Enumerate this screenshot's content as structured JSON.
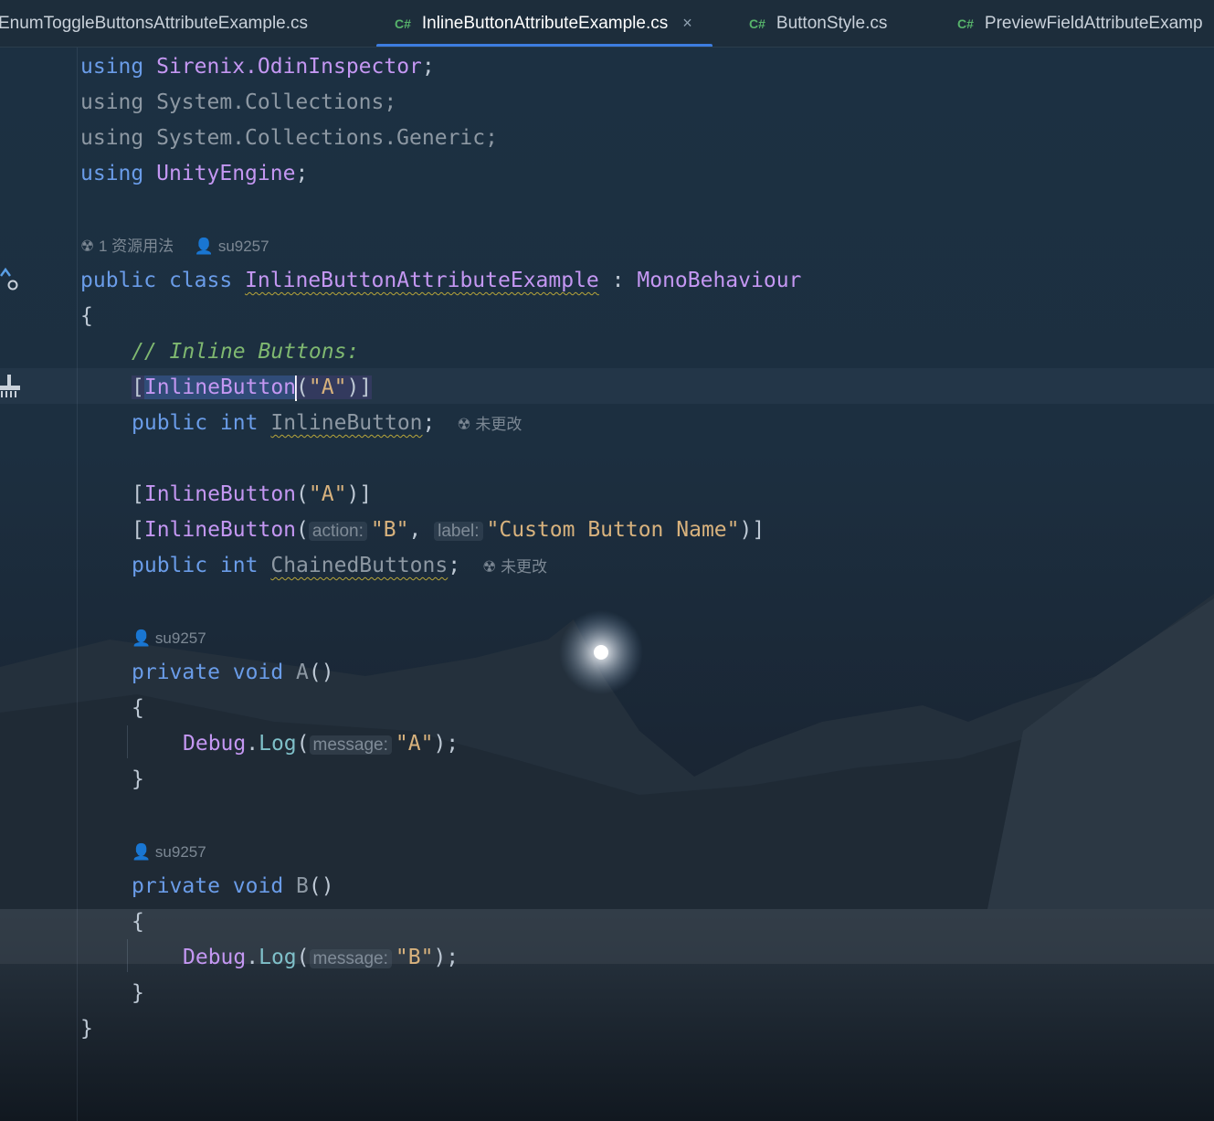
{
  "tabs": [
    {
      "label": "EnumToggleButtonsAttributeExample.cs",
      "lang": "",
      "active": false
    },
    {
      "label": "InlineButtonAttributeExample.cs",
      "lang": "C#",
      "active": true
    },
    {
      "label": "ButtonStyle.cs",
      "lang": "C#",
      "active": false
    },
    {
      "label": "PreviewFieldAttributeExamp",
      "lang": "C#",
      "active": false
    }
  ],
  "close_glyph": "×",
  "code": {
    "using1_kw": "using",
    "using1_ns": "Sirenix.OdinInspector",
    "semi": ";",
    "using2": "using System.Collections;",
    "using3": "using System.Collections.Generic;",
    "using4_kw": "using",
    "using4_ns": "UnityEngine",
    "class_meta_usages": "1 资源用法",
    "author": "su9257",
    "kw_public": "public",
    "kw_class": "class",
    "class_name": "InlineButtonAttributeExample",
    "colon": ":",
    "base_class": "MonoBehaviour",
    "brace_open": "{",
    "brace_close": "}",
    "comment": "// Inline Buttons:",
    "attr_name": "InlineButton",
    "str_A": "\"A\"",
    "str_B": "\"B\"",
    "str_custom": "\"Custom Button Name\"",
    "hint_action": "action:",
    "hint_label": "label:",
    "hint_message": "message:",
    "kw_int": "int",
    "field1": "InlineButton",
    "field2": "ChainedButtons",
    "not_changed": "未更改",
    "kw_private": "private",
    "kw_void": "void",
    "method_A": "A",
    "method_B": "B",
    "parens": "()",
    "debug": "Debug",
    "log": "Log"
  }
}
